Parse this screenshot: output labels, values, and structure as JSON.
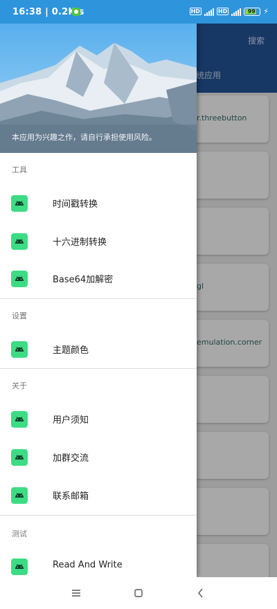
{
  "status": {
    "time": "16:38",
    "speed": "0.2K/s",
    "battery": "99"
  },
  "background_app": {
    "search_label": "搜索",
    "tab_label": "统应用",
    "cards": [
      "r.threebutton",
      "",
      "",
      "gl",
      "emulation.corner",
      "",
      "",
      "",
      ""
    ]
  },
  "drawer": {
    "disclaimer": "本应用为兴趣之作，请自行承担使用风险。",
    "sections": [
      {
        "title": "工具",
        "items": [
          "时间戳转换",
          "十六进制转换",
          "Base64加解密"
        ]
      },
      {
        "title": "设置",
        "items": [
          "主题颜色"
        ]
      },
      {
        "title": "关于",
        "items": [
          "用户须知",
          "加群交流",
          "联系邮箱"
        ]
      },
      {
        "title": "测试",
        "items": [
          "Read And Write"
        ]
      }
    ]
  },
  "colors": {
    "status_bar": "#2e94dc",
    "app_header": "#1f4a86",
    "icon_green": "#3ddc84"
  }
}
